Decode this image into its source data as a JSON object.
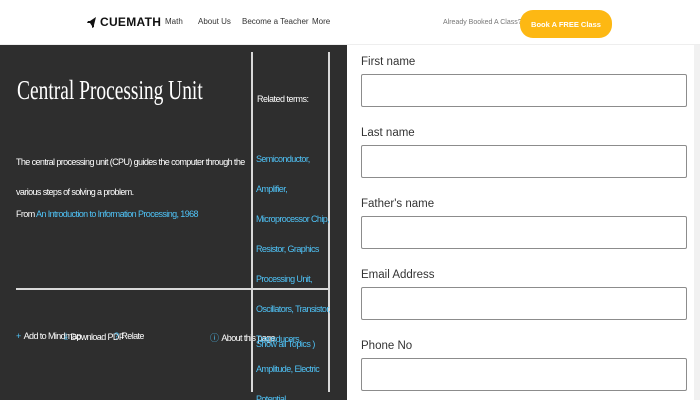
{
  "nav": {
    "brand": "CUEMATH",
    "links": [
      "Math",
      "About Us",
      "Become a Teacher",
      "More"
    ],
    "booked_text": "Already Booked A Class?",
    "cta_label": "Book A FREE Class",
    "cta_color": "#fdb813"
  },
  "term": {
    "title": "Central Processing Unit",
    "description": "The central processing unit (CPU) guides the computer through the various steps of solving a problem.",
    "from_label": "From ",
    "from_link": "An Introduction to Information Processing, 1968",
    "actions": [
      {
        "icon": "+",
        "label": "Add to Mindmap"
      },
      {
        "icon": "⤓",
        "label": "Download PDF"
      },
      {
        "icon": "?",
        "label": "Relate"
      },
      {
        "icon": "ⓘ",
        "label": "About this page"
      }
    ]
  },
  "related": {
    "title": "Related terms:",
    "items": [
      "Semiconductor",
      "Amplifier",
      "Microprocessor Chip",
      "Resistor",
      "Graphics Processing Unit",
      "Oscillators",
      "Transistor",
      "Transducers",
      "Amplitude",
      "Electric Potential"
    ],
    "show_all": "Show all Topics )"
  },
  "form": {
    "fields": [
      {
        "label": "First name",
        "value": ""
      },
      {
        "label": "Last name",
        "value": ""
      },
      {
        "label": "Father's name",
        "value": ""
      },
      {
        "label": "Email Address",
        "value": ""
      },
      {
        "label": "Phone No",
        "value": ""
      }
    ]
  },
  "colors": {
    "panel_bg": "#2e2e2e",
    "link_blue": "#4fc3f7"
  }
}
